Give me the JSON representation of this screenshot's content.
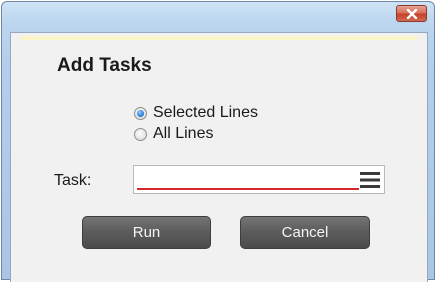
{
  "window": {
    "close_icon": "close-icon"
  },
  "dialog": {
    "title": "Add Tasks",
    "options": [
      {
        "label": "Selected Lines",
        "checked": true
      },
      {
        "label": "All Lines",
        "checked": false
      }
    ],
    "task_label": "Task:",
    "task_value": "",
    "task_menu_icon": "menu-icon"
  },
  "buttons": {
    "run": "Run",
    "cancel": "Cancel"
  },
  "colors": {
    "frame": "#b3cfeb",
    "close": "#c4422b",
    "button": "#5b5b5b",
    "error_underline": "#d8262b",
    "accent_strip": "#fbf6c7"
  }
}
